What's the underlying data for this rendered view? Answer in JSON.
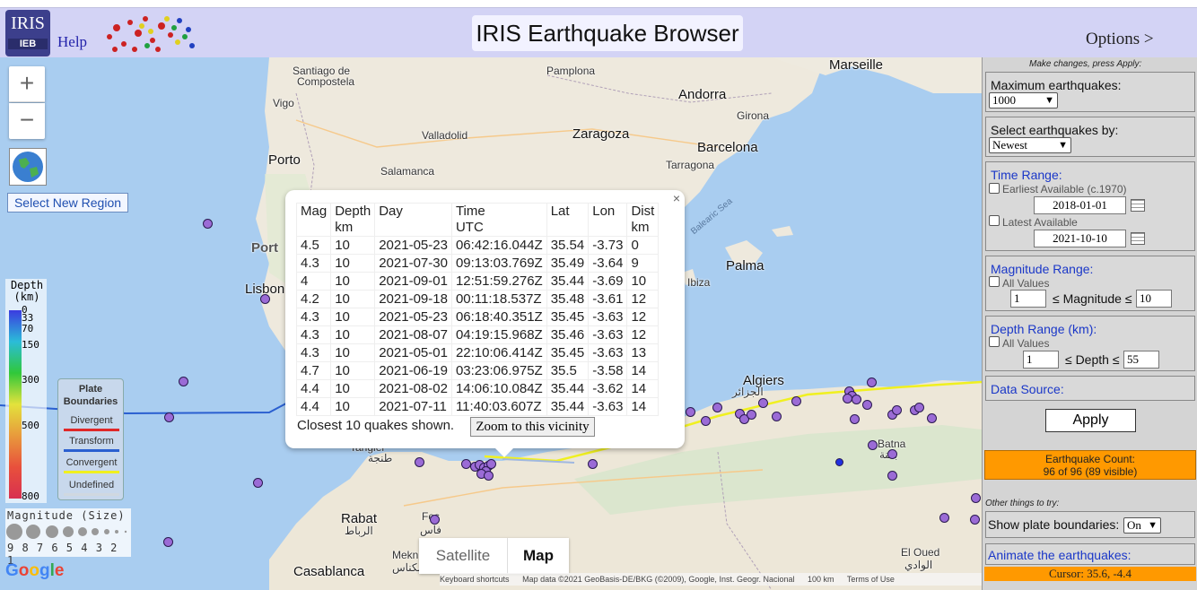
{
  "header": {
    "logo_text": "IRIS",
    "logo_sub": "IEB",
    "help": "Help",
    "title": "IRIS Earthquake Browser",
    "options": "Options >"
  },
  "map": {
    "cities": [
      {
        "name": "Santiago de",
        "big": false
      },
      {
        "name": "Compostela",
        "big": false
      },
      {
        "name": "Pamplona",
        "big": false
      },
      {
        "name": "Andorra",
        "big": true
      },
      {
        "name": "Marseille",
        "big": true
      },
      {
        "name": "Vigo",
        "big": false
      },
      {
        "name": "Girona",
        "big": false
      },
      {
        "name": "Valladolid",
        "big": false
      },
      {
        "name": "Zaragoza",
        "big": true
      },
      {
        "name": "Barcelona",
        "big": true
      },
      {
        "name": "Porto",
        "big": true
      },
      {
        "name": "Tarragona",
        "big": false
      },
      {
        "name": "Salamanca",
        "big": false
      },
      {
        "name": "Balearic Sea",
        "big": false
      },
      {
        "name": "Port",
        "big": true
      },
      {
        "name": "Palma",
        "big": true
      },
      {
        "name": "Lisbon",
        "big": true
      },
      {
        "name": "Ibiza",
        "big": false
      },
      {
        "name": "Algiers",
        "big": true
      },
      {
        "name": "الجزائر",
        "big": false
      },
      {
        "name": "Tangier",
        "big": false
      },
      {
        "name": "طنجة",
        "big": false
      },
      {
        "name": "Batna",
        "big": false
      },
      {
        "name": "باتنة",
        "big": false
      },
      {
        "name": "Rabat",
        "big": true
      },
      {
        "name": "الرباط",
        "big": false
      },
      {
        "name": "Fes",
        "big": false
      },
      {
        "name": "فاس",
        "big": false
      },
      {
        "name": "Mekn",
        "big": false
      },
      {
        "name": "مكناس",
        "big": false
      },
      {
        "name": "Casablanca",
        "big": true
      },
      {
        "name": "El Oued",
        "big": false
      },
      {
        "name": "الوادي",
        "big": false
      }
    ],
    "select_region": "Select New Region",
    "zoom_in": "+",
    "zoom_out": "−",
    "depth_legend": {
      "title1": "Depth",
      "title2": "(km)",
      "ticks": [
        "0",
        "33",
        "70",
        "150",
        "300",
        "500",
        "800"
      ],
      "colors": [
        "#3b3be0",
        "#2bbcd8",
        "#30c83a",
        "#e3e23c",
        "#e89a3c",
        "#e8503c",
        "#d83050"
      ]
    },
    "plate_legend": {
      "title1": "Plate",
      "title2": "Boundaries",
      "items": [
        {
          "label": "Divergent",
          "color": "#e02828"
        },
        {
          "label": "Transform",
          "color": "#2a5fd0"
        },
        {
          "label": "Convergent",
          "color": "#f0f020"
        },
        {
          "label": "Undefined",
          "color": "#d0d8e0"
        }
      ]
    },
    "mag_legend": {
      "title": "Magnitude (Size)",
      "numbers": "9 8 7 6 5 4 3 2 1"
    },
    "google": "Google",
    "satellite": "Satellite",
    "map_btn": "Map",
    "attribution": [
      "Keyboard shortcuts",
      "Map data ©2021 GeoBasis-DE/BKG (©2009), Google, Inst. Geogr. Nacional",
      "100 km",
      "Terms of Use"
    ],
    "quake_color": "#9b6bd6",
    "selected_quake_color": "#2030e0"
  },
  "popup": {
    "close": "×",
    "headers": [
      {
        "l1": "Mag",
        "l2": ""
      },
      {
        "l1": "Depth",
        "l2": "km"
      },
      {
        "l1": "Day",
        "l2": ""
      },
      {
        "l1": "Time",
        "l2": "UTC"
      },
      {
        "l1": "Lat",
        "l2": ""
      },
      {
        "l1": "Lon",
        "l2": ""
      },
      {
        "l1": "Dist",
        "l2": "km"
      }
    ],
    "rows": [
      [
        "4.5",
        "10",
        "2021-05-23",
        "06:42:16.044Z",
        "35.54",
        "-3.73",
        "0"
      ],
      [
        "4.3",
        "10",
        "2021-07-30",
        "09:13:03.769Z",
        "35.49",
        "-3.64",
        "9"
      ],
      [
        "4",
        "10",
        "2021-09-01",
        "12:51:59.276Z",
        "35.44",
        "-3.69",
        "10"
      ],
      [
        "4.2",
        "10",
        "2021-09-18",
        "00:11:18.537Z",
        "35.48",
        "-3.61",
        "12"
      ],
      [
        "4.3",
        "10",
        "2021-05-23",
        "06:18:40.351Z",
        "35.45",
        "-3.63",
        "12"
      ],
      [
        "4.3",
        "10",
        "2021-08-07",
        "04:19:15.968Z",
        "35.46",
        "-3.63",
        "12"
      ],
      [
        "4.3",
        "10",
        "2021-05-01",
        "22:10:06.414Z",
        "35.45",
        "-3.63",
        "13"
      ],
      [
        "4.7",
        "10",
        "2021-06-19",
        "03:23:06.975Z",
        "35.5",
        "-3.58",
        "14"
      ],
      [
        "4.4",
        "10",
        "2021-08-02",
        "14:06:10.084Z",
        "35.44",
        "-3.62",
        "14"
      ],
      [
        "4.4",
        "10",
        "2021-07-11",
        "11:40:03.607Z",
        "35.44",
        "-3.63",
        "14"
      ]
    ],
    "closest": "Closest 10 quakes shown.",
    "zoom_vicinity": "Zoom to this vicinity"
  },
  "panel": {
    "hint": "Make changes, press Apply:",
    "max_label": "Maximum earthquakes:",
    "max_value": "1000",
    "select_by_label": "Select earthquakes by:",
    "select_by_value": "Newest",
    "time_range": "Time Range:",
    "earliest": "Earliest Available (c.1970)",
    "start_date": "2018-01-01",
    "latest": "Latest Available",
    "end_date": "2021-10-10",
    "mag_range": "Magnitude Range:",
    "all_values": "All Values",
    "mag_min": "1",
    "mag_mid": "≤ Magnitude ≤",
    "mag_max": "10",
    "depth_range": "Depth Range (km):",
    "depth_min": "1",
    "depth_mid": "≤ Depth ≤",
    "depth_max": "55",
    "data_source": "Data Source:",
    "apply": "Apply",
    "count_l1": "Earthquake Count:",
    "count_l2": "96 of 96 (89 visible)",
    "other": "Other things to try:",
    "plate_label": "Show plate boundaries:",
    "plate_value": "On",
    "animate": "Animate the earthquakes:",
    "cursor": "Cursor: 35.6, -4.4"
  }
}
